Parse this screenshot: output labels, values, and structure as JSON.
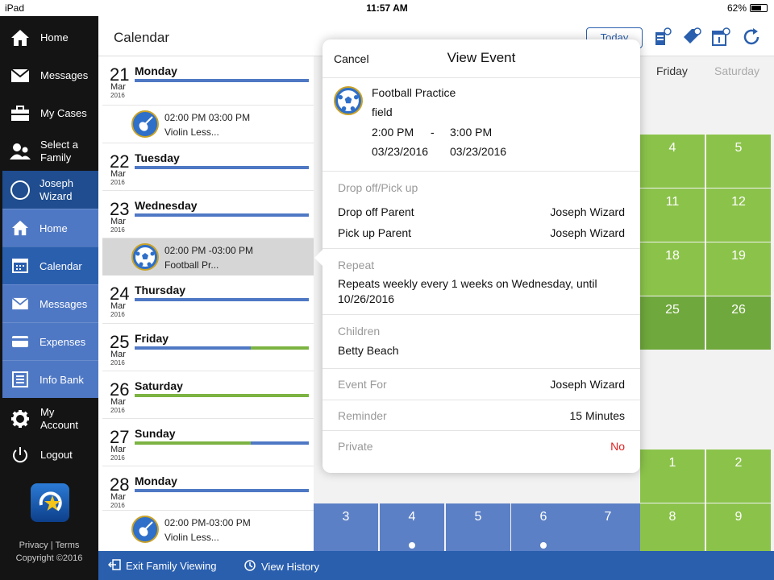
{
  "status": {
    "device": "iPad",
    "time": "11:57 AM",
    "battery": "62%"
  },
  "sidebar": {
    "items": [
      {
        "label": "Home"
      },
      {
        "label": "Messages"
      },
      {
        "label": "My Cases"
      },
      {
        "label": "Select a Family"
      }
    ],
    "user": {
      "label": "Joseph Wizard"
    },
    "sub_items": [
      {
        "label": "Home"
      },
      {
        "label": "Calendar"
      },
      {
        "label": "Messages"
      },
      {
        "label": "Expenses"
      },
      {
        "label": "Info Bank"
      }
    ],
    "bottom_items": [
      {
        "label": "My Account"
      },
      {
        "label": "Logout"
      }
    ],
    "footer": {
      "privacy": "Privacy",
      "terms": "Terms",
      "copyright": "Copyright ©2016"
    }
  },
  "header": {
    "title": "Calendar",
    "today": "Today"
  },
  "list": {
    "days": [
      {
        "num": "21",
        "mon": "Mar",
        "yr": "2016",
        "name": "Monday"
      },
      {
        "num": "22",
        "mon": "Mar",
        "yr": "2016",
        "name": "Tuesday"
      },
      {
        "num": "23",
        "mon": "Mar",
        "yr": "2016",
        "name": "Wednesday"
      },
      {
        "num": "24",
        "mon": "Mar",
        "yr": "2016",
        "name": "Thursday"
      },
      {
        "num": "25",
        "mon": "Mar",
        "yr": "2016",
        "name": "Friday"
      },
      {
        "num": "26",
        "mon": "Mar",
        "yr": "2016",
        "name": "Saturday"
      },
      {
        "num": "27",
        "mon": "Mar",
        "yr": "2016",
        "name": "Sunday"
      },
      {
        "num": "28",
        "mon": "Mar",
        "yr": "2016",
        "name": "Monday"
      }
    ],
    "events": [
      {
        "time": "02:00 PM  03:00 PM",
        "name": "Violin Less..."
      },
      {
        "time": "02:00 PM -03:00 PM",
        "name": "Football Pr..."
      },
      {
        "time": "02:00 PM-03:00 PM",
        "name": "Violin Less..."
      }
    ]
  },
  "grid": {
    "weekdays": [
      "Friday",
      "Saturday"
    ],
    "rows": [
      [
        "4",
        "5"
      ],
      [
        "11",
        "12"
      ],
      [
        "18",
        "19"
      ],
      [
        "25",
        "26"
      ],
      [
        "1",
        "2"
      ]
    ],
    "bottom_row": [
      "3",
      "4",
      "5",
      "6",
      "7",
      "8",
      "9"
    ]
  },
  "popup": {
    "cancel": "Cancel",
    "title": "View Event",
    "event_name": "Football Practice",
    "location": "field",
    "start_time": "2:00 PM",
    "dash": "-",
    "end_time": "3:00 PM",
    "start_date": "03/23/2016",
    "end_date": "03/23/2016",
    "dropoff_section": "Drop off/Pick up",
    "dropoff_label": "Drop off Parent",
    "dropoff_value": "Joseph Wizard",
    "pickup_label": "Pick up Parent",
    "pickup_value": "Joseph Wizard",
    "repeat_section": "Repeat",
    "repeat_text": "Repeats weekly every 1 weeks on Wednesday,  until 10/26/2016",
    "children_section": "Children",
    "children_value": "Betty Beach",
    "event_for_label": "Event For",
    "event_for_value": "Joseph Wizard",
    "reminder_label": "Reminder",
    "reminder_value": "15 Minutes",
    "private_label": "Private",
    "private_value": "No"
  },
  "bottombar": {
    "exit": "Exit Family Viewing",
    "history": "View History"
  },
  "colors": {
    "accent": "#2a5fae",
    "green": "#8bc34a",
    "red": "#e02020"
  }
}
